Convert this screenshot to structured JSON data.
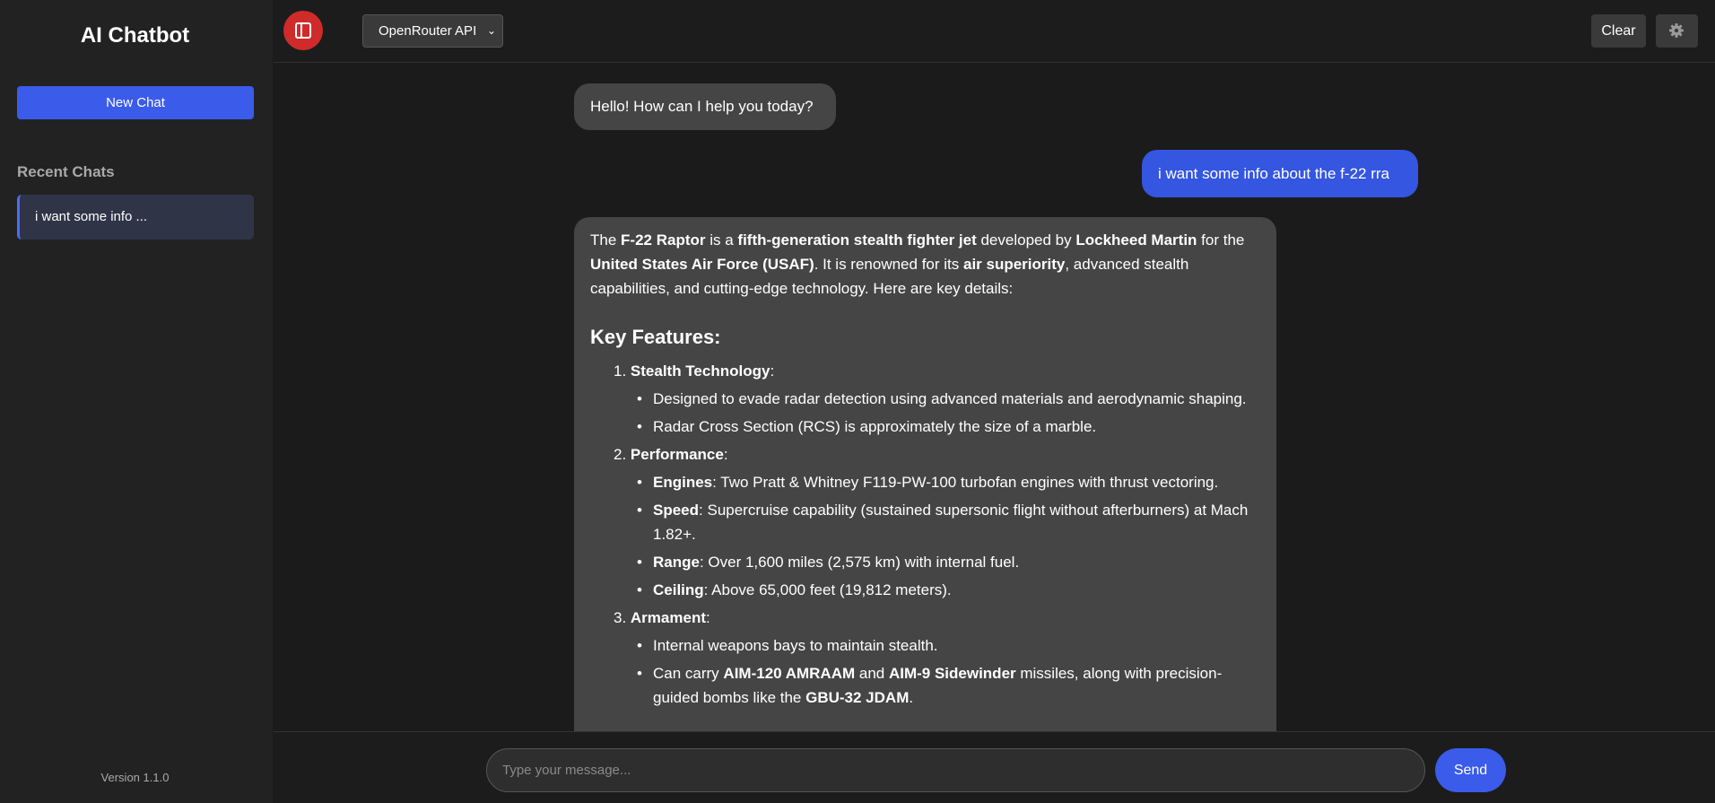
{
  "sidebar": {
    "title": "AI Chatbot",
    "new_chat_label": "New Chat",
    "recent_title": "Recent Chats",
    "recent_items": [
      {
        "label": "i want some info ..."
      }
    ],
    "version": "Version 1.1.0"
  },
  "header": {
    "provider_selected": "OpenRouter API",
    "clear_label": "Clear"
  },
  "messages": {
    "bot_greeting": "Hello! How can I help you today?",
    "user_message": "i want some info about the f-22 rra",
    "bot_answer": {
      "intro": [
        {
          "t": "The "
        },
        {
          "t": "F-22 Raptor",
          "b": true
        },
        {
          "t": " is a "
        },
        {
          "t": "fifth-generation stealth fighter jet",
          "b": true
        },
        {
          "t": " developed by "
        },
        {
          "t": "Lockheed Martin",
          "b": true
        },
        {
          "t": " for the "
        },
        {
          "t": "United States Air Force (USAF)",
          "b": true
        },
        {
          "t": ". It is renowned for its "
        },
        {
          "t": "air superiority",
          "b": true
        },
        {
          "t": ", advanced stealth capabilities, and cutting-edge technology. Here are key details:"
        }
      ],
      "heading": "Key Features:",
      "sections": [
        {
          "number": "1.",
          "title": "Stealth Technology",
          "items": [
            [
              {
                "t": "Designed to evade radar detection using advanced materials and aerodynamic shaping."
              }
            ],
            [
              {
                "t": "Radar Cross Section (RCS) is approximately the size of a marble."
              }
            ]
          ]
        },
        {
          "number": "2.",
          "title": "Performance",
          "items": [
            [
              {
                "t": "Engines",
                "b": true
              },
              {
                "t": ": Two Pratt & Whitney F119-PW-100 turbofan engines with thrust vectoring."
              }
            ],
            [
              {
                "t": "Speed",
                "b": true
              },
              {
                "t": ": Supercruise capability (sustained supersonic flight without afterburners) at Mach 1.82+."
              }
            ],
            [
              {
                "t": "Range",
                "b": true
              },
              {
                "t": ": Over 1,600 miles (2,575 km) with internal fuel."
              }
            ],
            [
              {
                "t": "Ceiling",
                "b": true
              },
              {
                "t": ": Above 65,000 feet (19,812 meters)."
              }
            ]
          ]
        },
        {
          "number": "3.",
          "title": "Armament",
          "items": [
            [
              {
                "t": "Internal weapons bays to maintain stealth."
              }
            ],
            [
              {
                "t": "Can carry "
              },
              {
                "t": "AIM-120 AMRAAM",
                "b": true
              },
              {
                "t": " and "
              },
              {
                "t": "AIM-9 Sidewinder",
                "b": true
              },
              {
                "t": " missiles, along with precision-guided bombs like the "
              },
              {
                "t": "GBU-32 JDAM",
                "b": true
              },
              {
                "t": "."
              }
            ]
          ]
        }
      ]
    }
  },
  "input": {
    "placeholder": "Type your message...",
    "send_label": "Send"
  },
  "colors": {
    "accent": "#3b5bea",
    "toggle": "#cf2b2b",
    "background": "#1b1b1b",
    "sidebar": "#222222",
    "bot_bubble": "#454545"
  },
  "icons": {
    "toggle": "sidebar-panel-icon",
    "settings": "gear-icon",
    "select": "chevron-down-icon"
  }
}
